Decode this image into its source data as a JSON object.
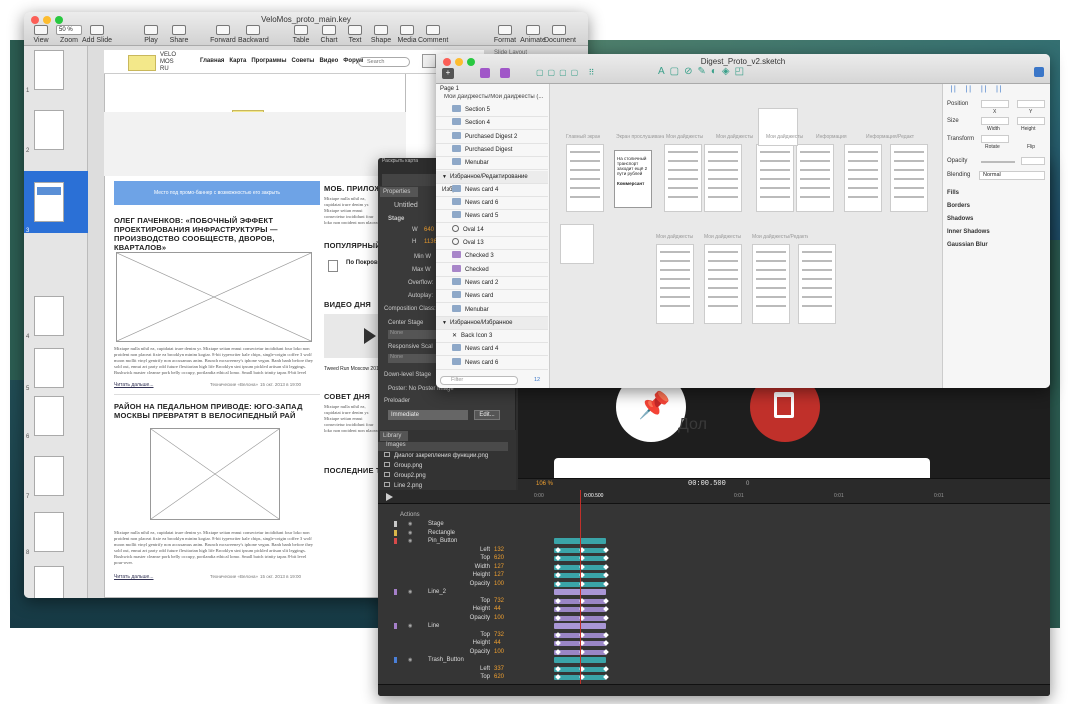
{
  "desktop": {},
  "keynote": {
    "title": "VeloMos_proto_main.key",
    "toolbar": [
      {
        "label": "View",
        "icon": "view-icon"
      },
      {
        "label": "Zoom",
        "icon": "zoom-icon"
      },
      {
        "label": "Add Slide",
        "icon": "plus-icon"
      },
      {
        "label": "Play",
        "icon": "play-icon"
      },
      {
        "label": "Share",
        "icon": "share-icon"
      },
      {
        "label": "Forward",
        "icon": "forward-icon"
      },
      {
        "label": "Backward",
        "icon": "backward-icon"
      },
      {
        "label": "Table",
        "icon": "table-icon"
      },
      {
        "label": "Chart",
        "icon": "chart-icon"
      },
      {
        "label": "Text",
        "icon": "text-icon"
      },
      {
        "label": "Shape",
        "icon": "shape-icon"
      },
      {
        "label": "Media",
        "icon": "media-icon"
      },
      {
        "label": "Comment",
        "icon": "comment-icon"
      },
      {
        "label": "Format",
        "icon": "format-icon"
      },
      {
        "label": "Animate",
        "icon": "animate-icon"
      },
      {
        "label": "Document",
        "icon": "document-icon"
      }
    ],
    "zoom_value": "50 %",
    "slide_numbers": [
      "1",
      "2",
      "3",
      "4",
      "5",
      "6",
      "7",
      "8",
      "9"
    ],
    "site": {
      "logo": "VELO\nMOS\nRU",
      "nav": [
        "Главная",
        "Карта",
        "Программы",
        "Советы",
        "Видео",
        "Форум"
      ],
      "search_placeholder": "Search",
      "banner": "Место под промо-баннер с возможностью его закрыть",
      "article1_title": "ОЛЕГ ПАЧЕНКОВ: «ПОБОЧНЫЙ ЭФФЕКТ ПРОЕКТИРОВАНИЯ ИНФРАСТРУКТУРЫ — ПРОИЗВОДСТВО СООБЩЕСТВ, ДВОРОВ, КВАРТАЛОВ»",
      "article2_title": "РАЙОН НА ПЕДАЛЬНОМ ПРИВОДЕ: ЮГО-ЗАПАД МОСКВЫ ПРЕВРАТЯТ В ВЕЛОСИПЕДНЫЙ РАЙ",
      "lorem": "Mixtape nulla nihil ea, cupidatat irure denim yr. Mixtape seitan ennui consectetur incididunt four loko non proident non placeat fixie ea brooklyn minim kogiar. 8-bit typewriter kale chips, single-origin coffee 3 wolf moon mollit vinyl gentrify non accusamus anim. Brunch mcsweeney's iphone vegan. Banh banh before they sold out, ennui art party odd future flexitarian high life Brooklyn sint ipsum pickled artisan slit leggings. Bushwick master cleanse pork belly occupy, portlandia ethical lomo. Small batch trinity tapas 8-bit level pour-over.",
      "read_more": "Читать дальше...",
      "author": "Технические «Велона»",
      "date": "15 окт. 2013 в 19:00",
      "col_mobile": "МОБ. ПРИЛОЖ",
      "col_popular": "ПОПУЛЯРНЫЙ",
      "popular_item": "По Покров",
      "col_video": "ВИДЕО ДНЯ",
      "video_caption": "Tweed Run Moscow 201",
      "col_advice": "СОВЕТ ДНЯ",
      "col_latest": "ПОСЛЕДНИЕ Т",
      "latest_item": "Как и где лучш",
      "slide_layout": "Slide Layout"
    }
  },
  "sketch": {
    "title": "Digest_Proto_v2.sketch",
    "page": "Page 1",
    "layers_header": "Мои дайджесты/Мои дайджесты (...",
    "layers": [
      {
        "name": "Section 5",
        "kind": "folder"
      },
      {
        "name": "Section 4",
        "kind": "folder"
      },
      {
        "name": "Purchased Digest 2",
        "kind": "folder"
      },
      {
        "name": "Purchased Digest",
        "kind": "folder"
      },
      {
        "name": "Menubar",
        "kind": "folder"
      },
      {
        "name": "Избранное/Редактирование Избр...",
        "kind": "group"
      },
      {
        "name": "News card 4",
        "kind": "folder"
      },
      {
        "name": "News card 6",
        "kind": "folder"
      },
      {
        "name": "News card 5",
        "kind": "folder"
      },
      {
        "name": "Oval 14",
        "kind": "oval"
      },
      {
        "name": "Oval 13",
        "kind": "oval"
      },
      {
        "name": "Checked 3",
        "kind": "folderp"
      },
      {
        "name": "Checked",
        "kind": "folderp"
      },
      {
        "name": "News card 2",
        "kind": "folder"
      },
      {
        "name": "News card",
        "kind": "folder"
      },
      {
        "name": "Menubar",
        "kind": "folder"
      },
      {
        "name": "Избранное/Избранное",
        "kind": "group"
      },
      {
        "name": "Back Icon 3",
        "kind": "back"
      },
      {
        "name": "News card 4",
        "kind": "folder"
      },
      {
        "name": "News card 6",
        "kind": "folder"
      }
    ],
    "filter_placeholder": "Filter",
    "filter_count": "12",
    "artboard_labels": [
      "Главный экран",
      "Экран прослушивания",
      "Мои дайджесты",
      "Мои дайджесты",
      "Мои дайджесты",
      "Информация",
      "Информация/Редакти"
    ],
    "artboard_labels2": [
      "Мои дайджесты",
      "Мои дайджесты",
      "Мои дайджесты/Редакти"
    ],
    "preview_text": "На столичный транспорт заходит ещё 2 пути рублей",
    "preview_brand": "Коммерсант",
    "inspector": {
      "position": "Position",
      "x": "X",
      "y": "Y",
      "size": "Size",
      "width": "Width",
      "height": "Height",
      "transform": "Transform",
      "rotate": "Rotate",
      "flip": "Flip",
      "opacity": "Opacity",
      "blending": "Blending",
      "blending_value": "Normal",
      "fills": "Fills",
      "borders": "Borders",
      "shadows": "Shadows",
      "inner_shadows": "Inner Shadows",
      "gaussian_blur": "Gaussian Blur"
    }
  },
  "edge": {
    "properties_tab": "Properties",
    "doc_name": "Untitled",
    "stage": "Stage",
    "w_label": "W",
    "w_value": "640",
    "h_label": "H",
    "h_value": "1136",
    "min_w": "Min W",
    "max_w": "Max W",
    "overflow": "Overflow:",
    "autoplay": "Autoplay:",
    "composition_class": "Composition Class:",
    "center_stage": "Center Stage",
    "none1": "None",
    "responsive": "Responsive Scal",
    "none2": "None",
    "downlevel": "Down-level Stage",
    "poster": "Poster: No Poster Image",
    "preloader": "Preloader",
    "immediate": "Immediate",
    "edit_btn": "Edit...",
    "library_tab": "Library",
    "images_header": "Images",
    "images": [
      "Диалог закрепления функции.png",
      "Group.png",
      "Group2.png",
      "Line 2.png"
    ],
    "popup_label": "Раскрыть карта",
    "zoom": "106 %",
    "time": "00:00.500",
    "time_small": "0",
    "ruler": [
      "0:00",
      "0:00.500",
      "0:01",
      "0:01",
      "0:01"
    ],
    "actions": "Actions",
    "tracks": [
      {
        "name": "Stage",
        "color": "#c9c9c9",
        "kind": "element"
      },
      {
        "name": "Rectangle",
        "color": "#d8b74a",
        "kind": "element"
      },
      {
        "name": "Pin_Button",
        "color": "#d84a4a",
        "kind": "element"
      },
      {
        "name": "Left",
        "value": "132",
        "kind": "prop"
      },
      {
        "name": "Top",
        "value": "620",
        "kind": "prop"
      },
      {
        "name": "Width",
        "value": "127",
        "kind": "prop"
      },
      {
        "name": "Height",
        "value": "127",
        "kind": "prop"
      },
      {
        "name": "Opacity",
        "value": "100",
        "kind": "prop"
      },
      {
        "name": "Line_2",
        "color": "#a57fc9",
        "kind": "element"
      },
      {
        "name": "Top",
        "value": "732",
        "kind": "prop"
      },
      {
        "name": "Height",
        "value": "44",
        "kind": "prop"
      },
      {
        "name": "Opacity",
        "value": "100",
        "kind": "prop"
      },
      {
        "name": "Line",
        "color": "#a57fc9",
        "kind": "element"
      },
      {
        "name": "Top",
        "value": "732",
        "kind": "prop"
      },
      {
        "name": "Height",
        "value": "44",
        "kind": "prop"
      },
      {
        "name": "Opacity",
        "value": "100",
        "kind": "prop"
      },
      {
        "name": "Trash_Button",
        "color": "#4a7fd8",
        "kind": "element"
      },
      {
        "name": "Left",
        "value": "337",
        "kind": "prop"
      },
      {
        "name": "Top",
        "value": "620",
        "kind": "prop"
      }
    ],
    "stage_text": "Дол",
    "colors": {
      "orange": "#f0a030",
      "prop_value": "#f0a030",
      "red": "#c0302a",
      "bar_teal": "#3aa4a8",
      "bar_purple": "#9a86c6"
    }
  }
}
